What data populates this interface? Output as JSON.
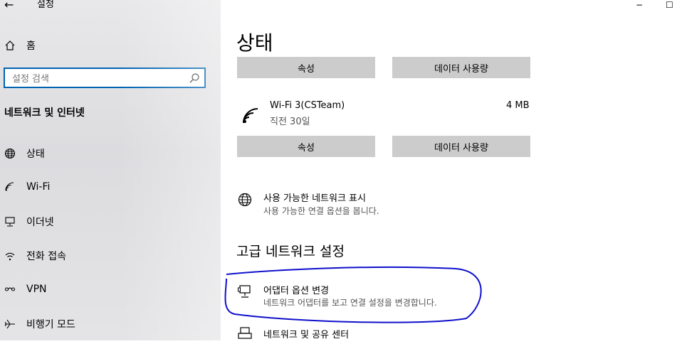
{
  "window": {
    "title": "설정",
    "back_glyph": "←",
    "minimize_glyph": "−",
    "maximize_glyph": "☐"
  },
  "sidebar": {
    "home_label": "홈",
    "search_placeholder": "설정 검색",
    "section_title": "네트워크 및 인터넷",
    "items": [
      {
        "label": "상태",
        "icon": "globe-icon"
      },
      {
        "label": "Wi-Fi",
        "icon": "wifi-icon"
      },
      {
        "label": "이더넷",
        "icon": "ethernet-icon"
      },
      {
        "label": "전화 접속",
        "icon": "dialup-icon"
      },
      {
        "label": "VPN",
        "icon": "vpn-icon"
      },
      {
        "label": "비행기 모드",
        "icon": "airplane-icon"
      }
    ]
  },
  "main": {
    "title": "상태",
    "top_buttons": {
      "properties": "속성",
      "data_usage": "데이터 사용량"
    },
    "network": {
      "name": "Wi-Fi 3(CSTeam)",
      "period": "직전 30일",
      "usage": "4 MB",
      "properties": "속성",
      "data_usage": "데이터 사용량"
    },
    "show_networks": {
      "title": "사용 가능한 네트워크 표시",
      "subtitle": "사용 가능한 연결 옵션을 봅니다."
    },
    "advanced_heading": "고급 네트워크 설정",
    "adapter_options": {
      "title": "어댑터 옵션 변경",
      "subtitle": "네트워크 어댑터를 보고 연결 설정을 변경합니다."
    },
    "sharing_center": {
      "title": "네트워크 및 공유 센터"
    }
  },
  "colors": {
    "accent": "#0063b1",
    "annotation": "#1010cc",
    "button_bg": "#cccccc"
  }
}
